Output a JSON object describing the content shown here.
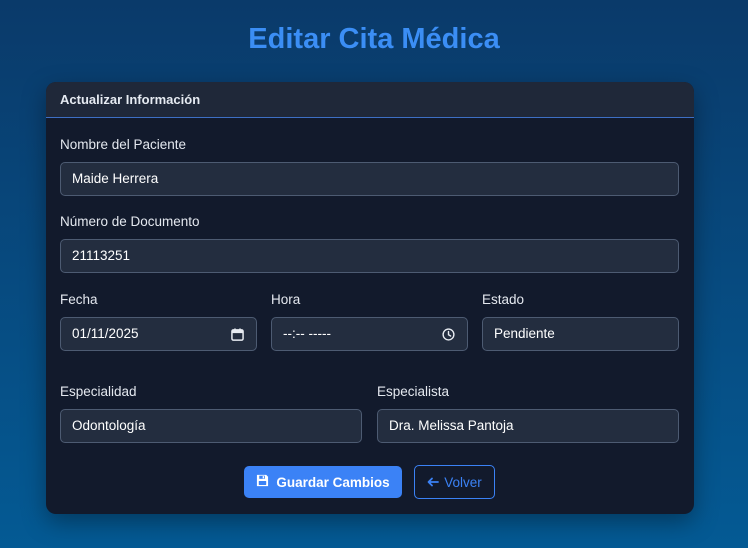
{
  "page": {
    "title": "Editar Cita Médica"
  },
  "card": {
    "header": "Actualizar Información"
  },
  "form": {
    "patient_name": {
      "label": "Nombre del Paciente",
      "value": "Maide Herrera"
    },
    "document_number": {
      "label": "Número de Documento",
      "value": "21113251"
    },
    "date": {
      "label": "Fecha",
      "value": "01/11/2025",
      "icon": "calendar-icon"
    },
    "time": {
      "label": "Hora",
      "value": "--:-- -----",
      "icon": "clock-icon"
    },
    "status": {
      "label": "Estado",
      "value": "Pendiente"
    },
    "specialty": {
      "label": "Especialidad",
      "value": "Odontología"
    },
    "specialist": {
      "label": "Especialista",
      "value": "Dra. Melissa Pantoja"
    }
  },
  "actions": {
    "save_label": "Guardar Cambios",
    "save_icon": "floppy-disk-icon",
    "back_label": "Volver",
    "back_icon": "arrow-left-icon"
  },
  "colors": {
    "accent": "#3b82f6",
    "title": "#3b8ef5",
    "card_bg": "#121a2c",
    "field_bg": "#232d3f"
  }
}
